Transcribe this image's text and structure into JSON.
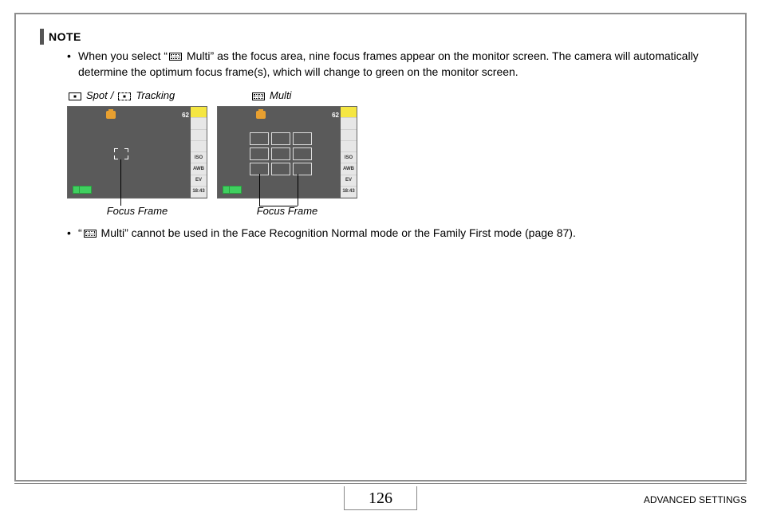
{
  "page": {
    "number": "126",
    "section": "ADVANCED SETTINGS"
  },
  "note": {
    "title": "NOTE",
    "bullets": [
      {
        "pre": "When you select “",
        "icon": "grid",
        "post": " Multi” as the focus area, nine focus frames appear on the monitor screen. The camera will automatically determine the optimum focus frame(s), which will change to green on the monitor screen."
      },
      {
        "pre": "“",
        "icon": "grid",
        "post": " Multi” cannot be used in the Face Recognition Normal mode or the Family First mode (page 87)."
      }
    ]
  },
  "diagram": {
    "label_spot": "Spot",
    "label_sep": " / ",
    "label_tracking": "Tracking",
    "label_multi": "Multi",
    "frame_label": "Focus Frame",
    "counter": "62",
    "time": "18:43",
    "sidebar": [
      "",
      "",
      "",
      "",
      "ISO",
      "AWB",
      "EV",
      "18:43"
    ]
  }
}
